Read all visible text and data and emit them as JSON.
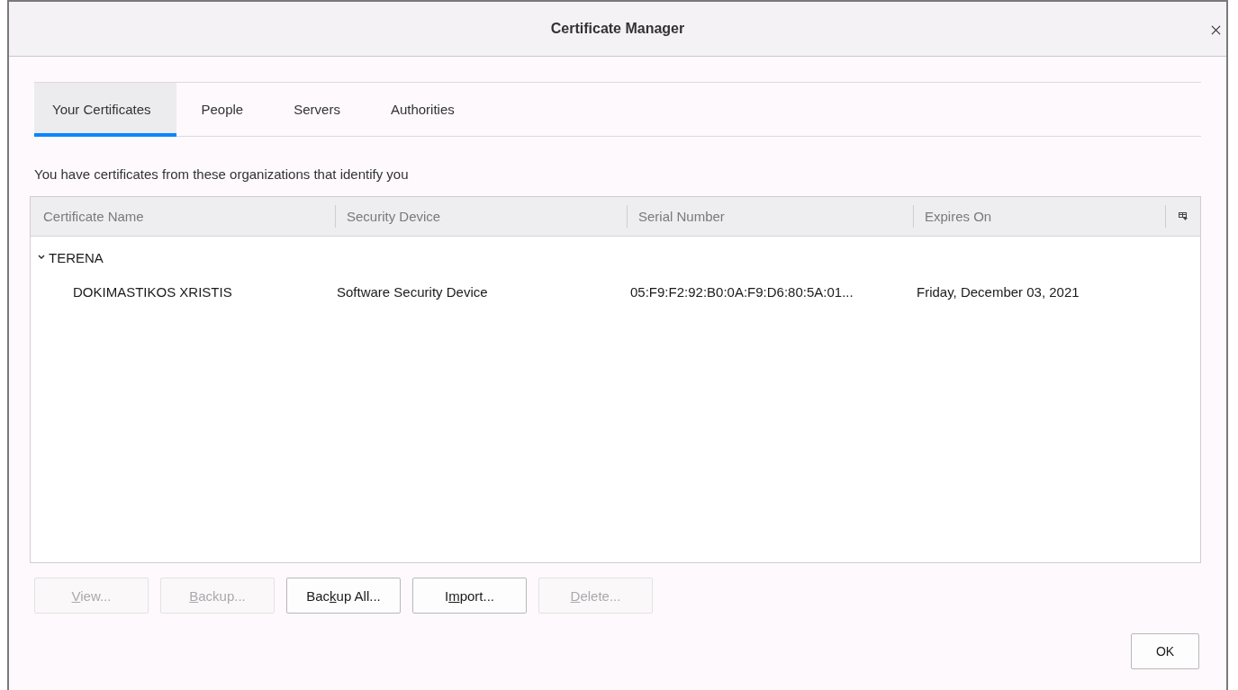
{
  "window": {
    "title": "Certificate Manager"
  },
  "tabs": [
    {
      "label": "Your Certificates",
      "selected": true
    },
    {
      "label": "People",
      "selected": false
    },
    {
      "label": "Servers",
      "selected": false
    },
    {
      "label": "Authorities",
      "selected": false
    }
  ],
  "description": "You have certificates from these organizations that identify you",
  "tree": {
    "columns": [
      "Certificate Name",
      "Security Device",
      "Serial Number",
      "Expires On"
    ],
    "rows": [
      {
        "label": "TERENA",
        "expanded": true,
        "children": [
          {
            "cells": [
              "DOKIMASTIKOS XRISTIS",
              "Software Security Device",
              "05:F9:F2:92:B0:0A:F9:D6:80:5A:01...",
              "Friday, December 03, 2021"
            ]
          }
        ]
      }
    ]
  },
  "buttons": [
    {
      "key": "V",
      "after": "iew...",
      "disabled": true
    },
    {
      "key": "B",
      "after": "ackup...",
      "disabled": true
    },
    {
      "before": "Bac",
      "key": "k",
      "after": "up All...",
      "disabled": false
    },
    {
      "before": "I",
      "key": "m",
      "after": "port...",
      "disabled": false
    },
    {
      "key": "D",
      "after": "elete...",
      "disabled": true
    }
  ],
  "ok_button": "OK"
}
